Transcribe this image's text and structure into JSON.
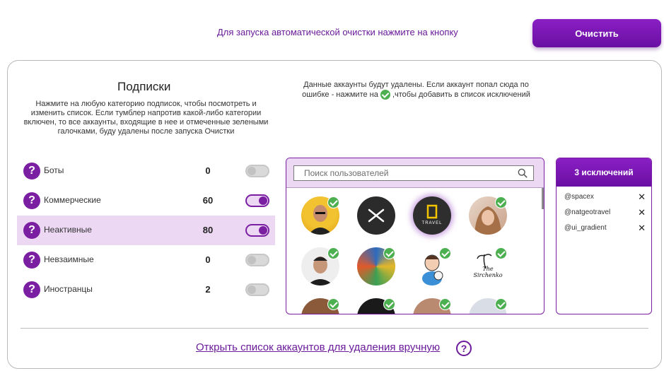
{
  "header": {
    "hint": "Для запуска автоматической очистки нажмите на кнопку",
    "clean_button": "Очистить"
  },
  "subscriptions": {
    "title": "Подписки",
    "description": "Нажмите на любую категорию подписок, чтобы посмотреть и изменить список. Если тумблер напротив какой-либо категории включен, то все аккаунты, входящие в нее и отмеченные зелеными галочками, буду удалены после запуска Очистки",
    "categories": [
      {
        "label": "Боты",
        "count": "0",
        "enabled": false,
        "selected": false
      },
      {
        "label": "Коммерческие",
        "count": "60",
        "enabled": true,
        "selected": false
      },
      {
        "label": "Неактивные",
        "count": "80",
        "enabled": true,
        "selected": true
      },
      {
        "label": "Невзаимные",
        "count": "0",
        "enabled": false,
        "selected": false
      },
      {
        "label": "Иностранцы",
        "count": "2",
        "enabled": false,
        "selected": false
      }
    ]
  },
  "accounts": {
    "description_before": "Данные аккаунты будут удалены. Если аккаунт попал сюда по ошибке - нажмите на ",
    "description_after": " ,чтобы добавить в список исключений",
    "search_placeholder": "Поиск пользователей",
    "avatar_text": {
      "travel": "TRAVEL",
      "signature": "The Sirchenko"
    }
  },
  "exclusions": {
    "title": "3 исключений",
    "items": [
      {
        "handle": "@spacex"
      },
      {
        "handle": "@natgeotravel"
      },
      {
        "handle": "@ui_gradient"
      }
    ],
    "remove_symbol": "✕"
  },
  "footer": {
    "manual_link": "Открыть список аккаунтов для удаления вручную",
    "help_symbol": "?"
  },
  "icons": {
    "category_help": "question-icon",
    "search": "search-icon",
    "check": "check-icon",
    "remove": "close-icon"
  },
  "colors": {
    "accent": "#7b1fa2",
    "highlight": "#ecd8f3",
    "check": "#4caf50"
  }
}
